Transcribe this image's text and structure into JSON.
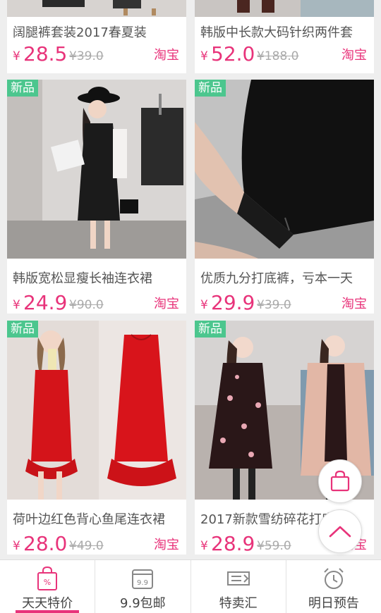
{
  "colors": {
    "accent": "#e8337a",
    "badge": "#4cc68e",
    "inactive_icon": "#888888"
  },
  "top_products": [
    {
      "title": "阔腿裤套装2017春夏装",
      "currency": "¥",
      "price": "28.5",
      "original_price": "¥39.0",
      "source": "淘宝"
    },
    {
      "title": "韩版中长款大码针织两件套",
      "currency": "¥",
      "price": "52.0",
      "original_price": "¥188.0",
      "source": "淘宝"
    }
  ],
  "products": [
    {
      "badge": "新品",
      "title": "韩版宽松显瘦长袖连衣裙",
      "currency": "¥",
      "price": "24.9",
      "original_price": "¥90.0",
      "source": "淘宝"
    },
    {
      "badge": "新品",
      "title": "优质九分打底裤，亏本一天",
      "currency": "¥",
      "price": "29.9",
      "original_price": "¥39.0",
      "source": "淘宝"
    },
    {
      "badge": "新品",
      "title": "荷叶边红色背心鱼尾连衣裙",
      "currency": "¥",
      "price": "28.0",
      "original_price": "¥49.0",
      "source": "淘宝"
    },
    {
      "badge": "新品",
      "title": "2017新款雪纺碎花打底裙",
      "currency": "¥",
      "price": "28.9",
      "original_price": "¥59.0",
      "source": "淘宝"
    }
  ],
  "floating": {
    "cart_icon": "shopping-bag-icon",
    "top_icon": "chevron-up-icon"
  },
  "tabbar": {
    "tabs": [
      {
        "label": "天天特价",
        "icon": "percent-bag-icon",
        "active": true
      },
      {
        "label": "9.9包邮",
        "icon": "box-9-9-icon",
        "icon_text": "9.9",
        "active": false
      },
      {
        "label": "特卖汇",
        "icon": "ticket-icon",
        "active": false
      },
      {
        "label": "明日预告",
        "icon": "alarm-clock-icon",
        "active": false
      }
    ]
  }
}
